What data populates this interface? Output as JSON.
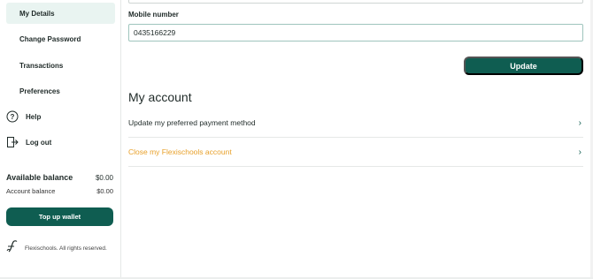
{
  "sidebar": {
    "items": [
      {
        "label": "My Details"
      },
      {
        "label": "Change Password"
      },
      {
        "label": "Transactions"
      },
      {
        "label": "Preferences"
      },
      {
        "label": "Help",
        "icon": "help-icon"
      },
      {
        "label": "Log out",
        "icon": "logout-icon"
      }
    ],
    "available_balance_label": "Available balance",
    "available_balance_value": "$0.00",
    "account_balance_label": "Account balance",
    "account_balance_value": "$0.00",
    "topup_label": "Top up wallet",
    "footer_text": "Flexischools. All rights reserved."
  },
  "form": {
    "mobile_label": "Mobile number",
    "mobile_value": "0435166229",
    "update_label": "Update"
  },
  "account": {
    "title": "My account",
    "rows": [
      {
        "label": "Update my preferred payment method"
      },
      {
        "label": "Close my Flexischools account"
      }
    ]
  },
  "colors": {
    "brand": "#0f5d51",
    "active_bg": "#e9f4f1",
    "warning": "#e8a02a"
  }
}
